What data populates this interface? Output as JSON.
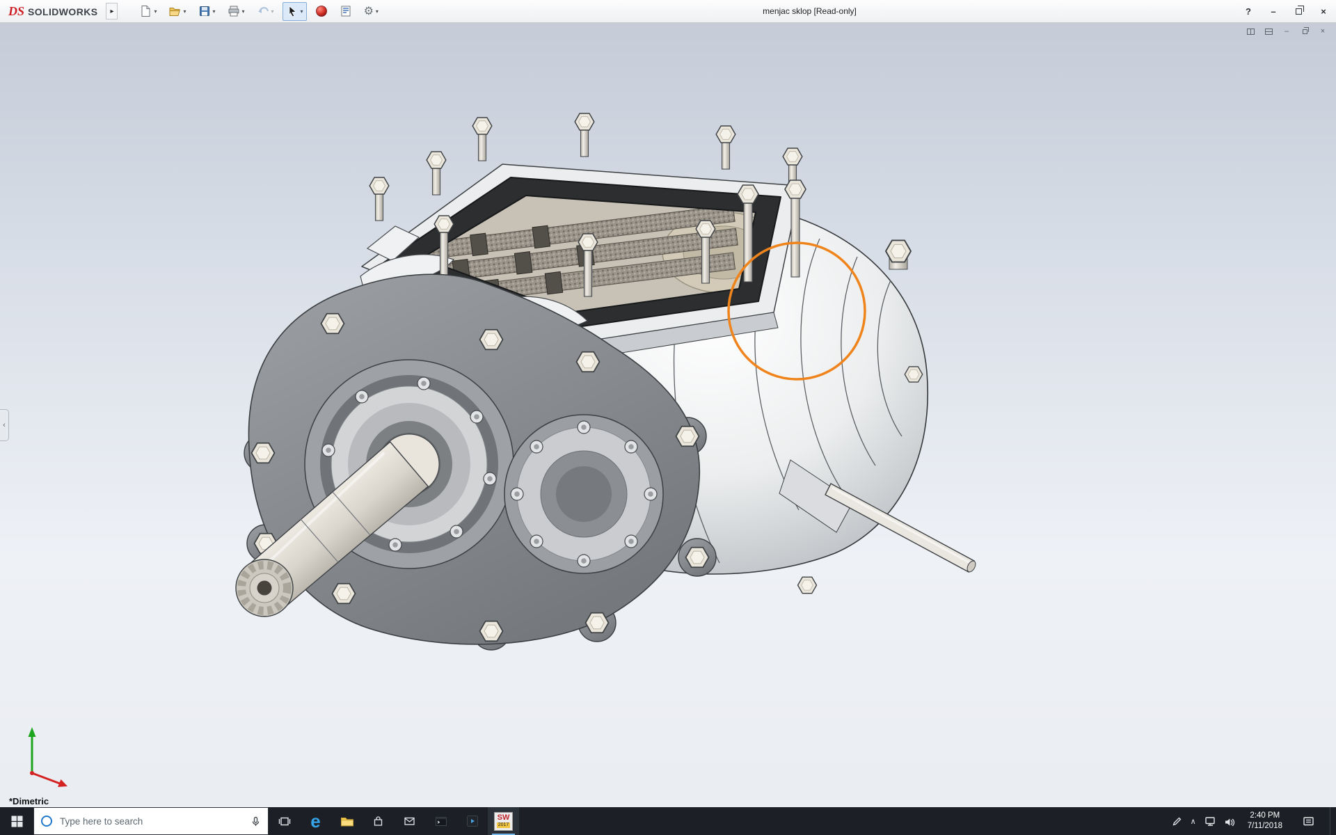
{
  "titlebar": {
    "brand": {
      "ds": "DS",
      "name": "SOLIDWORKS"
    },
    "title": "menjac sklop [Read-only]"
  },
  "icons": {
    "flyout": "▸",
    "dropdown": "▾",
    "help": "?",
    "minimize": "–",
    "close": "×",
    "gear": "⚙",
    "chevron_up": "∧",
    "collapse": "‹"
  },
  "viewport": {
    "view_label": "*Dimetric",
    "annotation_color": "#f0841c"
  },
  "taskbar": {
    "search_placeholder": "Type here to search",
    "clock": {
      "time": "2:40 PM",
      "date": "7/11/2018"
    },
    "edge_letter": "e",
    "sw_badge": {
      "letters": "SW",
      "year": "2017"
    }
  }
}
